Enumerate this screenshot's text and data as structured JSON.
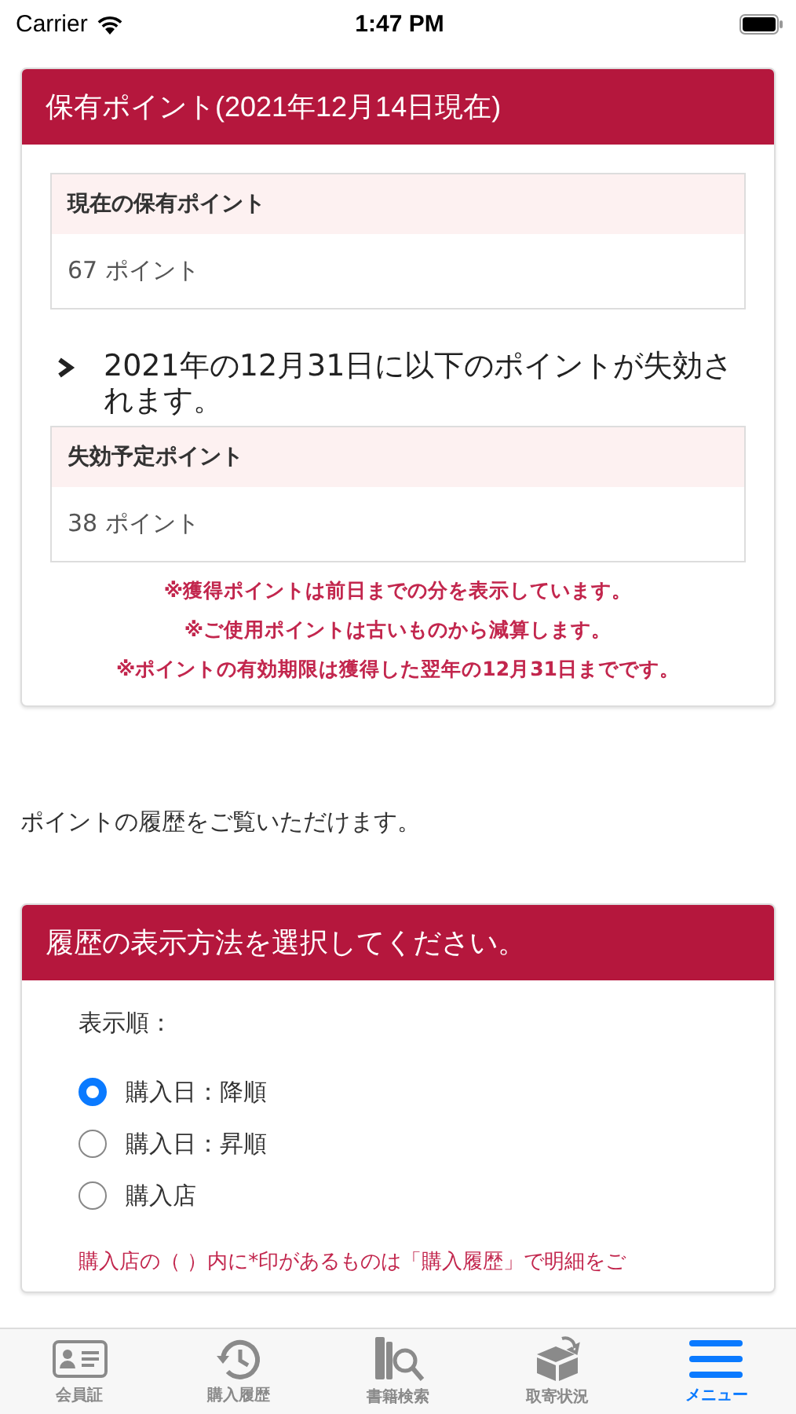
{
  "status_bar": {
    "carrier": "Carrier",
    "time": "1:47 PM"
  },
  "points_card": {
    "title": "保有ポイント(2021年12月14日現在)",
    "current": {
      "label": "現在の保有ポイント",
      "value": "67 ポイント"
    },
    "expiry_heading": "2021年の12月31日に以下のポイントが失効されます。",
    "expiring": {
      "label": "失効予定ポイント",
      "value": "38 ポイント"
    },
    "notes": [
      "※獲得ポイントは前日までの分を表示しています。",
      "※ご使用ポイントは古いものから減算します。",
      "※ポイントの有効期限は獲得した翌年の12月31日までです。"
    ]
  },
  "intro": "ポイントの履歴をご覧いただけます。",
  "history_card": {
    "title": "履歴の表示方法を選択してください。",
    "order_label": "表示順：",
    "options": [
      {
        "label": "購入日：降順",
        "selected": true
      },
      {
        "label": "購入日：昇順",
        "selected": false
      },
      {
        "label": "購入店",
        "selected": false
      }
    ],
    "note": "購入店の（ ）内に*印があるものは「購入履歴」で明細をご"
  },
  "tab_bar": [
    {
      "kind": "card",
      "label": "会員証",
      "selected": false
    },
    {
      "kind": "history",
      "label": "購入履歴",
      "selected": false
    },
    {
      "kind": "booksearch",
      "label": "書籍検索",
      "selected": false
    },
    {
      "kind": "parcel",
      "label": "取寄状況",
      "selected": false
    },
    {
      "kind": "menu",
      "label": "メニュー",
      "selected": true
    }
  ]
}
